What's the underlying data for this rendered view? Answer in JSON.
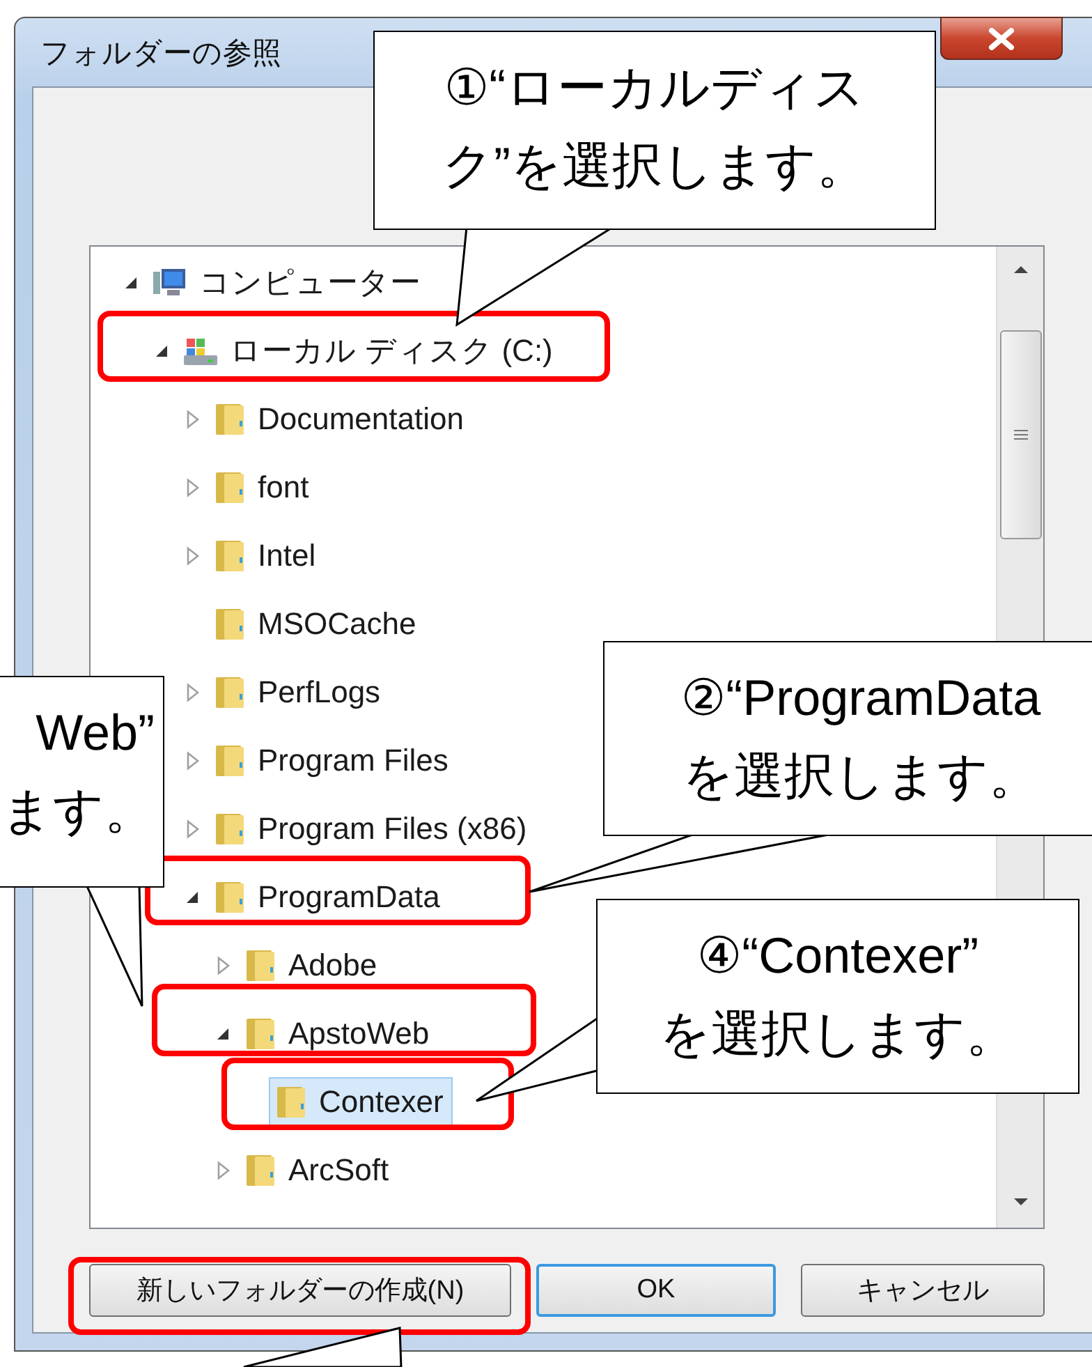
{
  "window": {
    "title": "フォルダーの参照"
  },
  "tree": {
    "items": [
      {
        "label": "コンピューター",
        "kind": "computer",
        "expanded": true,
        "selected": false,
        "children": [
          {
            "label": "ローカル ディスク (C:)",
            "kind": "drive",
            "expanded": true,
            "selected": false,
            "children": [
              {
                "label": "Documentation",
                "kind": "folder",
                "expanded": false,
                "selected": false
              },
              {
                "label": "font",
                "kind": "folder",
                "expanded": false,
                "selected": false
              },
              {
                "label": "Intel",
                "kind": "folder",
                "expanded": false,
                "selected": false
              },
              {
                "label": "MSOCache",
                "kind": "folder",
                "selected": false
              },
              {
                "label": "PerfLogs",
                "kind": "folder",
                "expanded": false,
                "selected": false
              },
              {
                "label": "Program Files",
                "kind": "folder",
                "expanded": false,
                "selected": false
              },
              {
                "label": "Program Files (x86)",
                "kind": "folder",
                "expanded": false,
                "selected": false
              },
              {
                "label": "ProgramData",
                "kind": "folder",
                "expanded": true,
                "selected": false,
                "children": [
                  {
                    "label": "Adobe",
                    "kind": "folder",
                    "expanded": false,
                    "selected": false
                  },
                  {
                    "label": "ApstoWeb",
                    "kind": "folder",
                    "expanded": true,
                    "selected": false,
                    "children": [
                      {
                        "label": "Contexer",
                        "kind": "folder",
                        "selected": true
                      }
                    ]
                  },
                  {
                    "label": "ArcSoft",
                    "kind": "folder",
                    "expanded": false,
                    "selected": false
                  }
                ]
              }
            ]
          }
        ]
      }
    ]
  },
  "buttons": [
    {
      "label": "新しいフォルダーの作成(N)",
      "default": false
    },
    {
      "label": "OK",
      "default": true
    },
    {
      "label": "キャンセル",
      "default": false
    }
  ],
  "callouts": [
    {
      "lines": [
        "①“ローカルディス",
        "ク”を選択します。"
      ]
    },
    {
      "lines": [
        "②“ProgramData",
        "を選択します。"
      ]
    },
    {
      "lines": [
        "Web”",
        "ます。"
      ]
    },
    {
      "lines": [
        "④“Contexer”",
        "を選択します。"
      ]
    }
  ]
}
